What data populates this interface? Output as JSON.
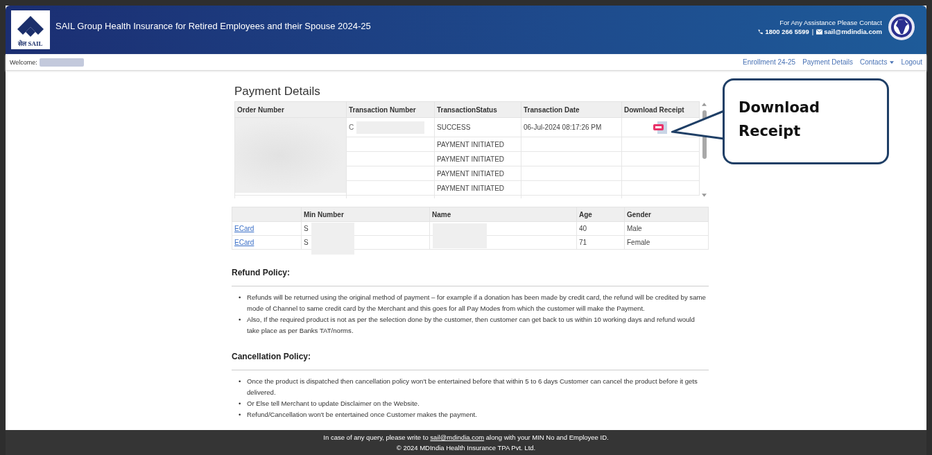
{
  "header": {
    "logo_caption": "सेल SAIL",
    "title": "SAIL Group Health Insurance for Retired Employees and their Spouse 2024-25",
    "assistance_label": "For Any Assistance Please Contact",
    "phone": "1800 266 5599",
    "separator": "|",
    "email": "sail@mdindia.com"
  },
  "nav": {
    "welcome_label": "Welcome:",
    "links": [
      {
        "label": "Enrollment 24-25",
        "kind": "link"
      },
      {
        "label": "Payment Details",
        "kind": "link"
      },
      {
        "label": "Contacts",
        "kind": "dropdown"
      },
      {
        "label": "Logout",
        "kind": "link"
      }
    ]
  },
  "page_title": "Payment Details",
  "payments": {
    "columns": [
      "Order Number",
      "Transaction Number",
      "TransactionStatus",
      "Transaction Date",
      "Download Receipt"
    ],
    "rows": [
      {
        "transaction_number": "C",
        "status": "SUCCESS",
        "date": "06-Jul-2024 08:17:26 PM",
        "receipt": true
      },
      {
        "status": "PAYMENT INITIATED",
        "receipt": false
      },
      {
        "status": "PAYMENT INITIATED",
        "receipt": false
      },
      {
        "status": "PAYMENT INITIATED",
        "receipt": false
      },
      {
        "status": "PAYMENT INITIATED",
        "receipt": false
      }
    ]
  },
  "members": {
    "columns": [
      "",
      "Min Number",
      "Name",
      "Age",
      "Gender"
    ],
    "rows": [
      {
        "link": "ECard",
        "min_number": "S",
        "age": "40",
        "gender": "Male"
      },
      {
        "link": "ECard",
        "min_number": "S",
        "age": "71",
        "gender": "Female"
      }
    ]
  },
  "policies": [
    {
      "heading": "Refund Policy:",
      "bullet": "•",
      "items": [
        "Refunds will be returned using the original method of payment – for example if a donation has been made by credit card, the refund will be credited by same mode of Channel to same credit card by the Merchant and this goes for all Pay Modes from which the customer will make the Payment.",
        "Also, If the required product is not as per the selection done by the customer, then customer can get back to us within 10 working days and refund would take place as per Banks TAT/norms."
      ]
    },
    {
      "heading": "Cancellation Policy:",
      "bullet": "•",
      "items": [
        "Once the product is dispatched then cancellation policy won't be entertained before that within 5 to 6 days Customer can cancel the product before it gets delivered.",
        "Or Else tell Merchant to update Disclaimer on the Website.",
        "Refund/Cancellation won't be entertained once Customer makes the payment."
      ]
    }
  ],
  "footer": {
    "query_before": "In case of any query, please write to",
    "query_email": "sail@mdindia.com",
    "query_after": "along with your MIN No and Employee ID.",
    "copyright": "© 2024 MDIndia Health Insurance TPA Pvt. Ltd."
  },
  "callout": {
    "text": "Download Receipt"
  }
}
